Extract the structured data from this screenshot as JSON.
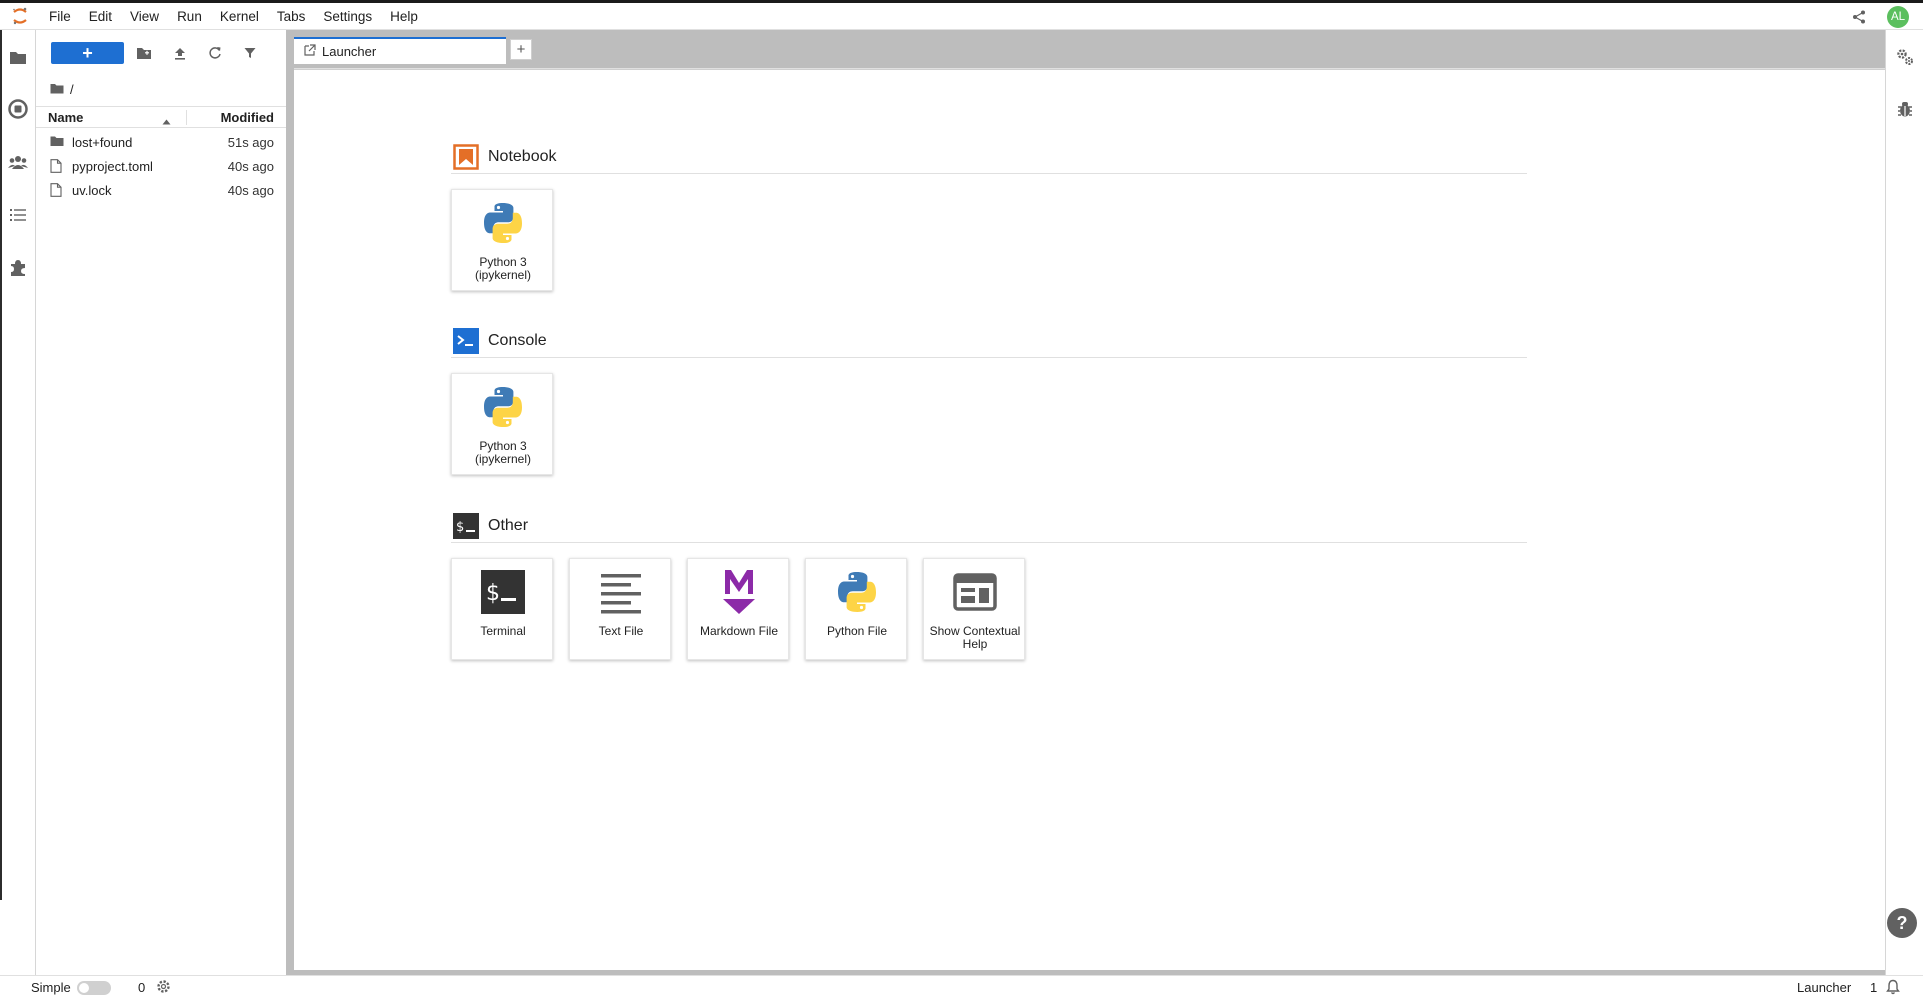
{
  "menubar": {
    "items": [
      "File",
      "Edit",
      "View",
      "Run",
      "Kernel",
      "Tabs",
      "Settings",
      "Help"
    ],
    "avatar_initials": "AL"
  },
  "filebrowser": {
    "new_button_label": "+",
    "breadcrumb": "/",
    "columns": {
      "name": "Name",
      "modified": "Modified"
    },
    "files": [
      {
        "name": "lost+found",
        "modified": "51s ago",
        "type": "folder"
      },
      {
        "name": "pyproject.toml",
        "modified": "40s ago",
        "type": "file"
      },
      {
        "name": "uv.lock",
        "modified": "40s ago",
        "type": "file"
      }
    ]
  },
  "tabs": [
    {
      "label": "Launcher",
      "icon": "launcher-icon"
    }
  ],
  "launcher": {
    "sections": [
      {
        "title": "Notebook",
        "cards": [
          {
            "label": "Python 3 (ipykernel)",
            "icon": "python-icon"
          }
        ]
      },
      {
        "title": "Console",
        "cards": [
          {
            "label": "Python 3 (ipykernel)",
            "icon": "python-icon"
          }
        ]
      },
      {
        "title": "Other",
        "cards": [
          {
            "label": "Terminal",
            "icon": "terminal-icon"
          },
          {
            "label": "Text File",
            "icon": "text-file-icon"
          },
          {
            "label": "Markdown File",
            "icon": "markdown-icon"
          },
          {
            "label": "Python File",
            "icon": "python-icon"
          },
          {
            "label": "Show Contextual Help",
            "icon": "contextual-help-icon"
          }
        ]
      }
    ]
  },
  "statusbar": {
    "mode_label": "Simple",
    "kernel_count": "0",
    "active_label": "Launcher",
    "notification_count": "1"
  },
  "colors": {
    "accent": "#1e6fd2",
    "avatar": "#5bbf5e",
    "notebook": "#e46f27",
    "console": "#1e6fd2",
    "markdown": "#8c2aa8"
  }
}
